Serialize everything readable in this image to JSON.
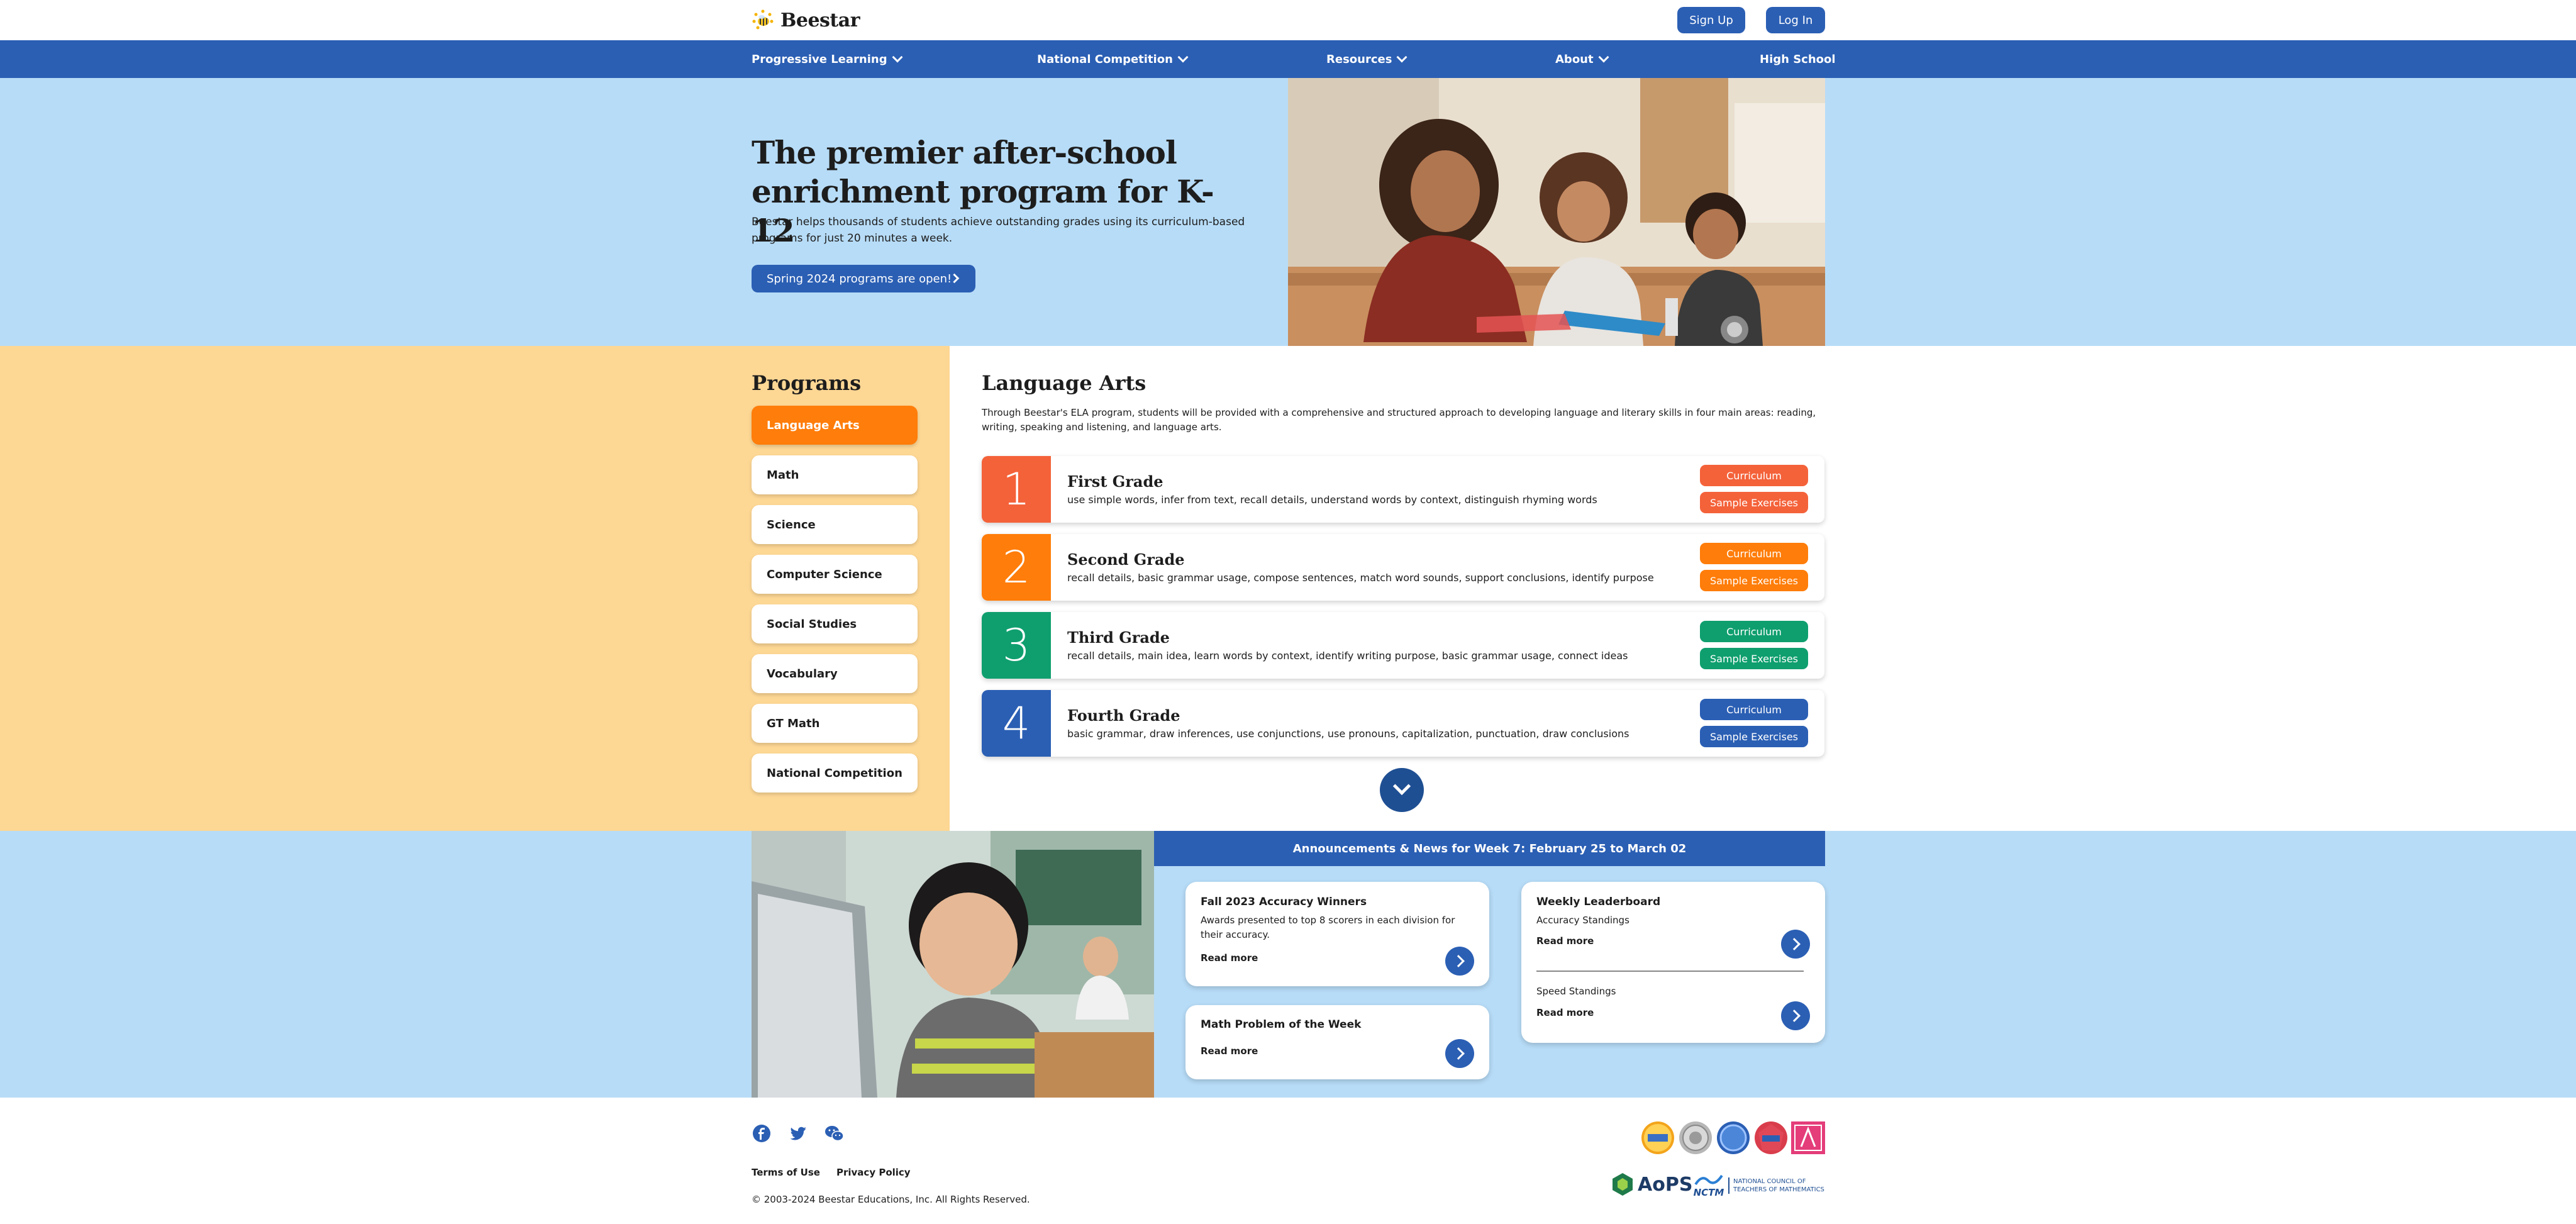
{
  "header": {
    "logo_text": "Beestar",
    "signup_label": "Sign Up",
    "login_label": "Log In"
  },
  "nav": {
    "items": [
      {
        "label": "Progressive Learning",
        "has_dropdown": true
      },
      {
        "label": "National Competition",
        "has_dropdown": true
      },
      {
        "label": "Resources",
        "has_dropdown": true
      },
      {
        "label": "About",
        "has_dropdown": true
      },
      {
        "label": "High School",
        "has_dropdown": false
      }
    ]
  },
  "hero": {
    "title": "The premier after-school enrichment program for K-12",
    "subtitle": "Beestar helps thousands of students achieve outstanding grades using its curriculum-based programs for just 20 minutes a week.",
    "cta_label": "Spring 2024 programs are open!"
  },
  "programs": {
    "title": "Programs",
    "items": [
      {
        "label": "Language Arts",
        "active": true
      },
      {
        "label": "Math",
        "active": false
      },
      {
        "label": "Science",
        "active": false
      },
      {
        "label": "Computer Science",
        "active": false
      },
      {
        "label": "Social Studies",
        "active": false
      },
      {
        "label": "Vocabulary",
        "active": false
      },
      {
        "label": "GT Math",
        "active": false
      },
      {
        "label": "National Competition",
        "active": false
      }
    ]
  },
  "language_arts": {
    "title": "Language Arts",
    "description": "Through Beestar's ELA program, students will be provided with a comprehensive and structured approach to developing language and literary skills in four main areas: reading, writing, speaking and listening, and language arts.",
    "grades": [
      {
        "number": "1",
        "name": "First Grade",
        "desc": "use simple words, infer from text, recall details, understand words by context, distinguish rhyming words",
        "color": "#f4623a",
        "curriculum_label": "Curriculum",
        "samples_label": "Sample Exercises"
      },
      {
        "number": "2",
        "name": "Second Grade",
        "desc": "recall details, basic grammar usage, compose sentences, match word sounds, support conclusions, identify purpose",
        "color": "#ff7d0a",
        "curriculum_label": "Curriculum",
        "samples_label": "Sample Exercises"
      },
      {
        "number": "3",
        "name": "Third Grade",
        "desc": "recall details, main idea, learn words by context, identify writing purpose, basic grammar usage, connect ideas",
        "color": "#0f9f6e",
        "curriculum_label": "Curriculum",
        "samples_label": "Sample Exercises"
      },
      {
        "number": "4",
        "name": "Fourth Grade",
        "desc": "basic grammar, draw inferences, use conjunctions, use pronouns, capitalization, punctuation, draw conclusions",
        "color": "#2b5fb4",
        "curriculum_label": "Curriculum",
        "samples_label": "Sample Exercises"
      }
    ]
  },
  "announcements": {
    "title": "Announcements & News for Week 7: February 25 to March 02",
    "cards": {
      "accuracy": {
        "title": "Fall 2023 Accuracy Winners",
        "desc": "Awards presented to top 8 scorers in each division for their accuracy.",
        "link": "Read more"
      },
      "problem": {
        "title": "Math Problem of the Week",
        "link": "Read more"
      },
      "leaderboard": {
        "title": "Weekly Leaderboard",
        "sub1": "Accuracy Standings",
        "link1": "Read more",
        "sub2": "Speed Standings",
        "link2": "Read more"
      }
    }
  },
  "footer": {
    "terms": "Terms of Use",
    "privacy": "Privacy Policy",
    "copyright": "© 2003-2024 Beestar Educations, Inc. All Rights Reserved.",
    "social": [
      "facebook-icon",
      "twitter-icon",
      "wechat-icon"
    ],
    "partners": {
      "aops": "AoPS",
      "nctm": "NCTM",
      "nctm_full_line1": "NATIONAL COUNCIL OF",
      "nctm_full_line2": "TEACHERS OF MATHEMATICS"
    }
  },
  "colors": {
    "brand_blue": "#2b5fb4",
    "hero_bg": "#b7dcf7",
    "programs_side_bg": "#fdd794",
    "active_orange": "#ff7d0a"
  }
}
